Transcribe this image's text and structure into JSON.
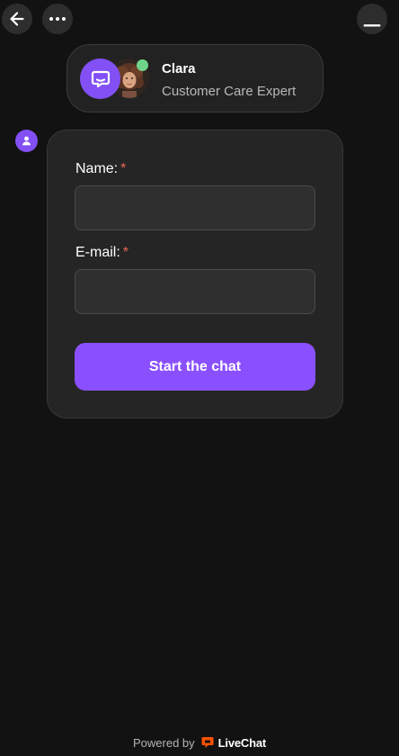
{
  "header": {
    "back_icon": "arrow-left-icon",
    "more_icon": "more-horizontal-icon",
    "minimize_icon": "minimize-icon"
  },
  "agent": {
    "name": "Clara",
    "role": "Customer Care Expert",
    "status": "online",
    "status_color": "#6fd38a"
  },
  "form": {
    "name_label": "Name:",
    "name_required": "*",
    "name_value": "",
    "email_label": "E-mail:",
    "email_required": "*",
    "email_value": "",
    "submit_label": "Start the chat"
  },
  "footer": {
    "powered_by": "Powered by",
    "brand": "LiveChat"
  },
  "colors": {
    "background": "#121212",
    "card": "#252525",
    "accent": "#8a50ff",
    "required": "#e5674f",
    "brand_logo": "#ff5100"
  }
}
